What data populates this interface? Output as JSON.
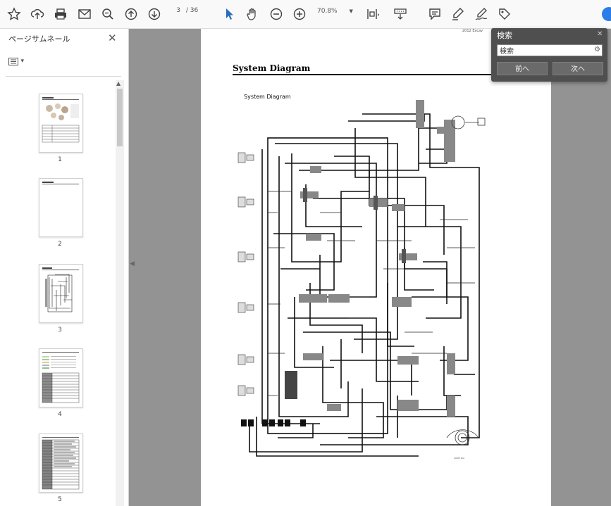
{
  "toolbar": {
    "icons": [
      "star-icon",
      "upload-icon",
      "print-icon",
      "mail-icon",
      "zoom-out-magnifier-icon",
      "page-up-icon",
      "page-down-icon",
      "select-cursor-icon",
      "hand-icon",
      "zoom-minus-icon",
      "zoom-plus-icon",
      "fit-page-icon",
      "keyboard-icon",
      "comment-icon",
      "highlight-pen-icon",
      "sign-icon",
      "share-tag-icon"
    ],
    "current_page": "3",
    "page_separator": "/",
    "total_pages": "36",
    "zoom_level": "70.8%",
    "zoom_dropdown": "▼"
  },
  "sidebar": {
    "title": "ページサムネール",
    "options_label": "▾",
    "thumbnails": [
      {
        "label": "1"
      },
      {
        "label": "2"
      },
      {
        "label": "3"
      },
      {
        "label": "4"
      },
      {
        "label": "5"
      }
    ]
  },
  "document": {
    "header_fragment": "2012 Excav",
    "heading": "System Diagram",
    "diagram_subtitle": "System Diagram"
  },
  "find_panel": {
    "title": "検索",
    "search_value": "検索",
    "prev_label": "前へ",
    "next_label": "次へ"
  }
}
